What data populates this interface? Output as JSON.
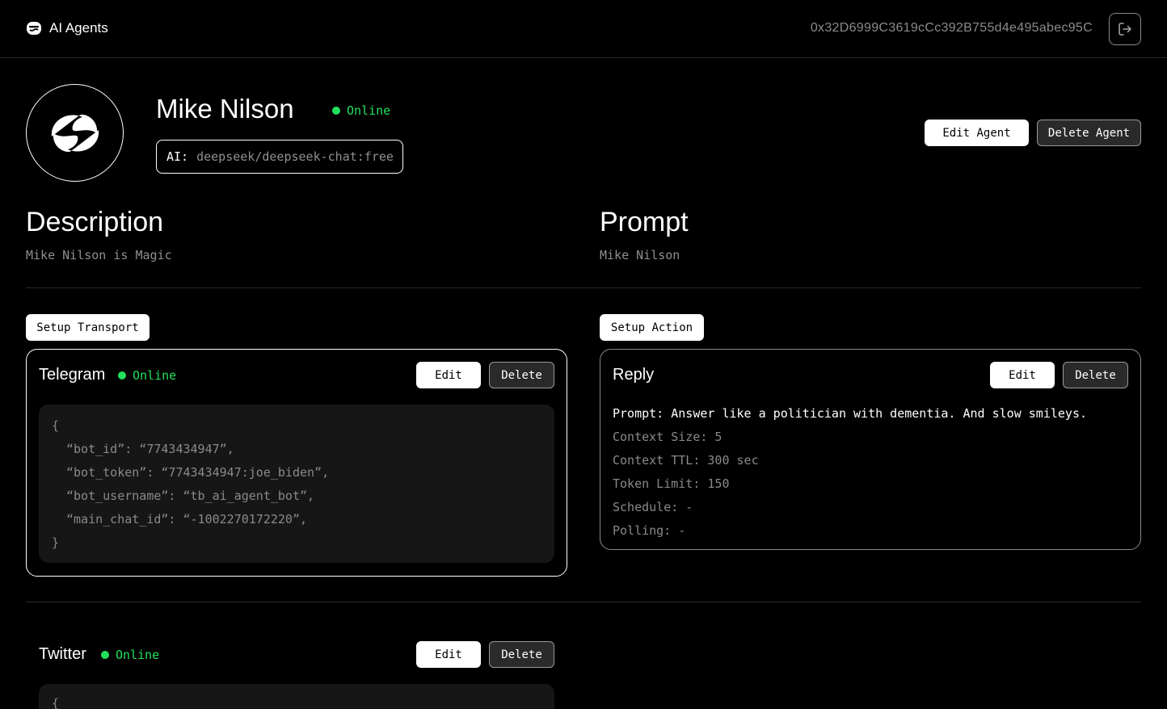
{
  "header": {
    "app_title": "AI Agents",
    "app_icon": "robot-logo-icon",
    "wallet_address": "0x32D6999C3619cCc392B755d4e495abec95C",
    "logout_icon": "logout-icon"
  },
  "agent": {
    "name": "Mike Nilson",
    "status": "Online",
    "ai_label": "AI:",
    "ai_model": "deepseek/deepseek-chat:free",
    "edit_label": "Edit Agent",
    "delete_label": "Delete Agent"
  },
  "description": {
    "title": "Description",
    "text": "Mike Nilson is Magic"
  },
  "prompt": {
    "title": "Prompt",
    "text": "Mike Nilson"
  },
  "transport": {
    "setup_label": "Setup Transport",
    "items": [
      {
        "name": "Telegram",
        "status": "Online",
        "edit_label": "Edit",
        "delete_label": "Delete",
        "config_lines": [
          "{",
          "“bot_id”: “7743434947”,",
          "“bot_token”: “7743434947:joe_biden”,",
          "“bot_username”: “tb_ai_agent_bot”,",
          "“main_chat_id”: “-1002270172220”,",
          "}"
        ]
      },
      {
        "name": "Twitter",
        "status": "Online",
        "edit_label": "Edit",
        "delete_label": "Delete",
        "config_lines": [
          "{"
        ]
      }
    ]
  },
  "action": {
    "setup_label": "Setup Action",
    "items": [
      {
        "name": "Reply",
        "edit_label": "Edit",
        "delete_label": "Delete",
        "prompt_line": "Prompt: Answer like a politician with dementia. And slow smileys.",
        "details": [
          "Context Size: 5",
          "Context TTL: 300 sec",
          "Token Limit: 150",
          "Schedule: -",
          "Polling: -"
        ]
      }
    ]
  },
  "colors": {
    "background": "#000000",
    "online": "#22e05c",
    "muted_text": "#8a8a8a",
    "code_bg": "#161616"
  }
}
